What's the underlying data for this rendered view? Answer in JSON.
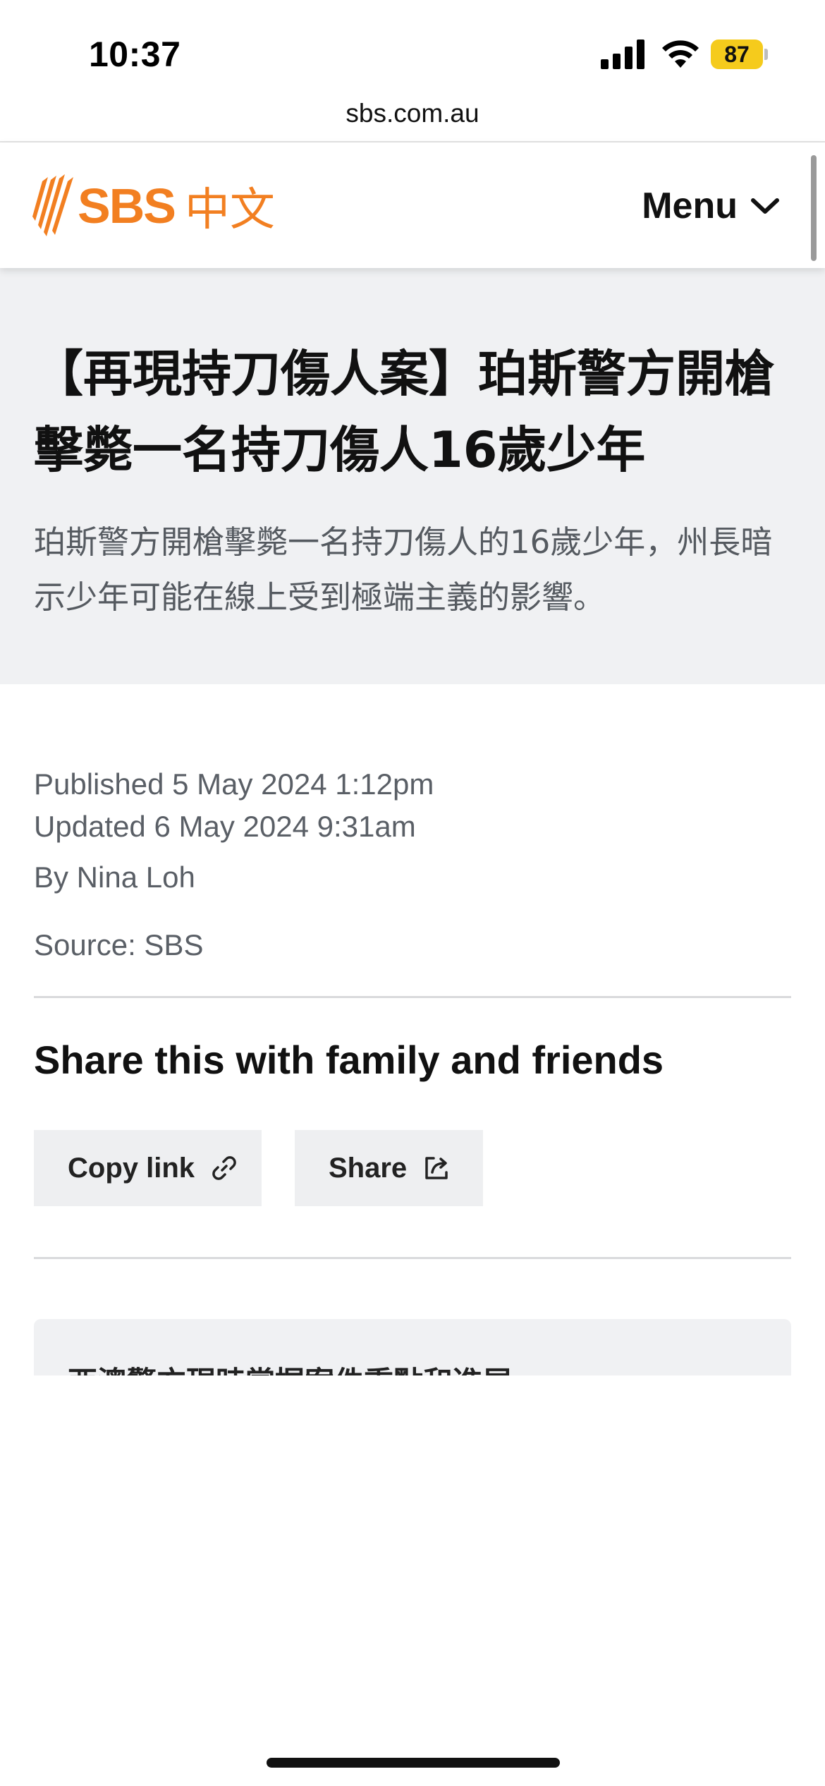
{
  "status_bar": {
    "time": "10:37",
    "battery": "87"
  },
  "browser": {
    "url": "sbs.com.au"
  },
  "header": {
    "logo_text": "SBS",
    "logo_cn": "中文",
    "menu_label": "Menu",
    "accent_color": "#f27f21"
  },
  "article": {
    "headline": "【再現持刀傷人案】珀斯警方開槍擊斃一名持刀傷人16歲少年",
    "subhead": "珀斯警方開槍擊斃一名持刀傷人的16歲少年，州長暗示少年可能在線上受到極端主義的影響。",
    "published": "Published 5 May 2024 1:12pm",
    "updated": "Updated 6 May 2024 9:31am",
    "byline": "By Nina Loh",
    "source": "Source: SBS"
  },
  "share": {
    "title": "Share this with family and friends",
    "copy_label": "Copy link",
    "share_label": "Share"
  },
  "info_box": {
    "text": "西澳警方現時掌握案件重點和進展:"
  }
}
